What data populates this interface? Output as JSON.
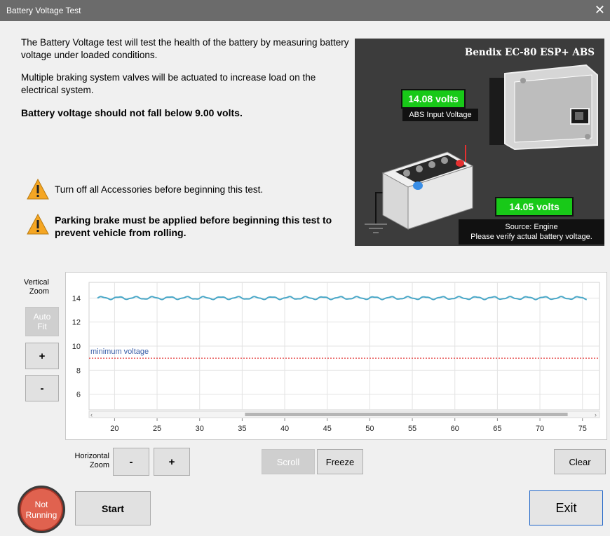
{
  "window": {
    "title": "Battery Voltage Test",
    "close_glyph": "✕"
  },
  "intro": {
    "p1": "The Battery Voltage test will test the health of the battery by measuring battery voltage under loaded conditions.",
    "p2": "Multiple braking system valves will be actuated to increase load on the electrical system.",
    "p3": "Battery voltage should not fall below 9.00 volts."
  },
  "warnings": [
    {
      "text": "Turn off all Accessories before beginning this test.",
      "icon": "warning-icon"
    },
    {
      "text": "Parking brake must be applied before beginning this test to prevent vehicle from rolling.",
      "icon": "warning-icon"
    }
  ],
  "panel": {
    "title": "Bendix EC-80 ESP+ ABS",
    "abs_voltage": "14.08 volts",
    "abs_caption": "ABS Input Voltage",
    "battery_voltage": "14.05 volts",
    "source_line1": "Source: Engine",
    "source_line2": "Please verify actual battery voltage.",
    "colors": {
      "background": "#3c3c3c",
      "value_box": "#18c918"
    }
  },
  "zoom": {
    "vertical_label": [
      "Vertical",
      "Zoom"
    ],
    "horizontal_label": [
      "Horizontal",
      "Zoom"
    ],
    "auto_fit": [
      "Auto",
      "Fit"
    ],
    "plus": "+",
    "minus": "-"
  },
  "buttons": {
    "scroll": "Scroll",
    "freeze": "Freeze",
    "clear": "Clear",
    "start": "Start",
    "exit": "Exit"
  },
  "status": {
    "line1": "Not",
    "line2": "Running",
    "color": "#e0624f"
  },
  "chart_data": {
    "type": "line",
    "xlim": [
      17,
      77
    ],
    "ylim": [
      4.7,
      15.3
    ],
    "x_ticks": [
      20,
      25,
      30,
      35,
      40,
      45,
      50,
      55,
      60,
      65,
      70,
      75
    ],
    "y_ticks": [
      6,
      8,
      10,
      12,
      14
    ],
    "grid": true,
    "series": [
      {
        "color": "#4aa8c8",
        "x_range": [
          18,
          75.5
        ],
        "baseline": 14.0,
        "ripple": 0.1,
        "ripple_period": 2
      }
    ],
    "threshold": {
      "value": 9.0,
      "label": "minimum voltage",
      "color": "#e02020"
    },
    "scrollbar": {
      "thumb_start": 0.3,
      "thumb_end": 0.95
    }
  }
}
